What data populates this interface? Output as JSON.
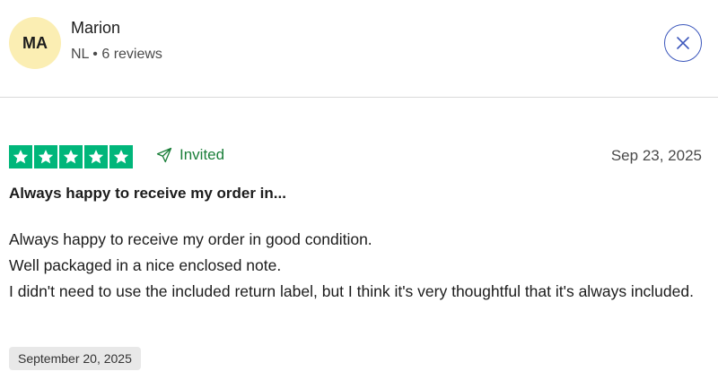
{
  "reviewer": {
    "initials": "MA",
    "name": "Marion",
    "meta": "NL • 6 reviews"
  },
  "review": {
    "rating": 5,
    "rating_max": 5,
    "star_color": "#00b67a",
    "invited_label": "Invited",
    "date": "Sep 23, 2025",
    "title": "Always happy to receive my order in...",
    "body_lines": [
      "Always happy to receive my order in good condition.",
      "Well packaged in a nice enclosed note.",
      "I didn't need to use the included return label, but I think it's very thoughtful that it's always included."
    ],
    "experience_date": "September 20, 2025"
  },
  "icons": {
    "close": "close-icon",
    "invited": "paper-plane-icon",
    "star": "star-icon"
  },
  "colors": {
    "avatar_bg": "#fbeeb3",
    "close_accent": "#3c57bc",
    "invited_green": "#1b7f3a"
  }
}
